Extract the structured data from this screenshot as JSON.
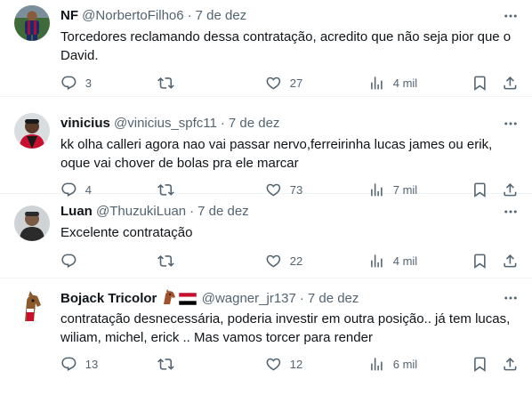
{
  "tweets": [
    {
      "name": "NF",
      "handle": "@NorbertoFilho6",
      "time": "7 de dez",
      "text": "Torcedores reclamando dessa contratação, acredito que não seja pior que o David.",
      "replies": "3",
      "retweets": "",
      "likes": "27",
      "views": "4 mil",
      "avatar_icon": "player-photo-avatar"
    },
    {
      "name": "vinicius",
      "handle": "@vinicius_spfc11",
      "time": "7 de dez",
      "text": "kk olha calleri agora nao vai passar nervo,ferreirinha lucas james ou erik, oque vai chover de bolas pra ele marcar",
      "replies": "4",
      "retweets": "",
      "likes": "73",
      "views": "7 mil",
      "avatar_icon": "person-photo-avatar"
    },
    {
      "name": "Luan",
      "handle": "@ThuzukiLuan",
      "time": "7 de dez",
      "text": "Excelente contratação",
      "replies": "",
      "retweets": "",
      "likes": "22",
      "views": "4 mil",
      "avatar_icon": "person-photo-avatar"
    },
    {
      "name": "Bojack Tricolor",
      "handle": "@wagner_jr137",
      "time": "7 de dez",
      "text": "contratação desnecessária, poderia investir em outra posição.. já tem lucas, wiliam, michel, erick .. Mas vamos torcer para render",
      "replies": "13",
      "retweets": "",
      "likes": "12",
      "views": "6 mil",
      "avatar_icon": "horse-cartoon-avatar",
      "name_emojis": [
        "horse-face-emoji",
        "tricolor-flag-emoji"
      ]
    }
  ],
  "colors": {
    "text": "#0f1419",
    "muted": "#536471",
    "border": "#eff3f4",
    "background": "#ffffff"
  }
}
